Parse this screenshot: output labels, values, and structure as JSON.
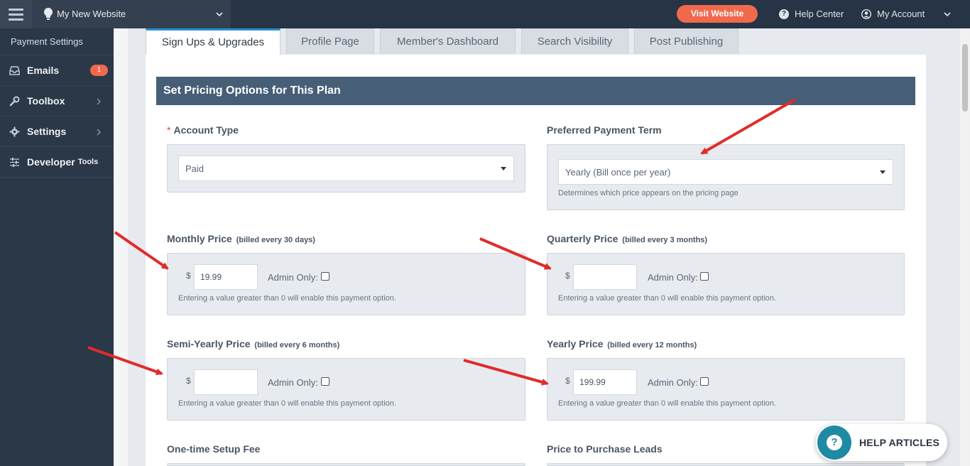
{
  "topbar": {
    "site_name": "My New Website",
    "visit_label": "Visit Website",
    "help_center": "Help Center",
    "my_account": "My Account"
  },
  "sidebar": {
    "title": "Payment Settings",
    "items": [
      {
        "label": "Emails",
        "icon": "inbox-icon",
        "badge": "1"
      },
      {
        "label": "Toolbox",
        "icon": "wrench-icon"
      },
      {
        "label": "Settings",
        "icon": "gear-icon"
      },
      {
        "label": "Developer",
        "suffix": "Tools",
        "icon": "sliders-icon"
      }
    ]
  },
  "tabs": [
    "Sign Ups & Upgrades",
    "Profile Page",
    "Member's Dashboard",
    "Search Visibility",
    "Post Publishing"
  ],
  "section": {
    "title": "Set Pricing Options for This Plan"
  },
  "form": {
    "account_type": {
      "label": "Account Type",
      "required": "*",
      "value": "Paid"
    },
    "payment_term": {
      "label": "Preferred Payment Term",
      "value": "Yearly (Bill once per year)",
      "hint": "Determines which price appears on the pricing page"
    },
    "monthly": {
      "label": "Monthly Price",
      "sub": "(billed every 30 days)",
      "currency": "$",
      "value": "19.99",
      "admin_label": "Admin Only:",
      "hint": "Entering a value greater than 0 will enable this payment option."
    },
    "quarterly": {
      "label": "Quarterly Price",
      "sub": "(billed every 3 months)",
      "currency": "$",
      "value": "",
      "admin_label": "Admin Only:",
      "hint": "Entering a value greater than 0 will enable this payment option."
    },
    "semi_yearly": {
      "label": "Semi-Yearly Price",
      "sub": "(billed every 6 months)",
      "currency": "$",
      "value": "",
      "admin_label": "Admin Only:",
      "hint": "Entering a value greater than 0 will enable this payment option."
    },
    "yearly": {
      "label": "Yearly Price",
      "sub": "(billed every 12 months)",
      "currency": "$",
      "value": "199.99",
      "admin_label": "Admin Only:",
      "hint": "Entering a value greater than 0 will enable this payment option."
    },
    "setup_fee": {
      "label": "One-time Setup Fee"
    },
    "leads_price": {
      "label": "Price to Purchase Leads"
    }
  },
  "help_widget": {
    "label": "HELP ARTICLES",
    "icon": "question-icon"
  },
  "colors": {
    "accent": "#f0694d",
    "sidebar": "#2a3847",
    "header": "#475e77",
    "annotation_arrow": "#e02b2b"
  }
}
